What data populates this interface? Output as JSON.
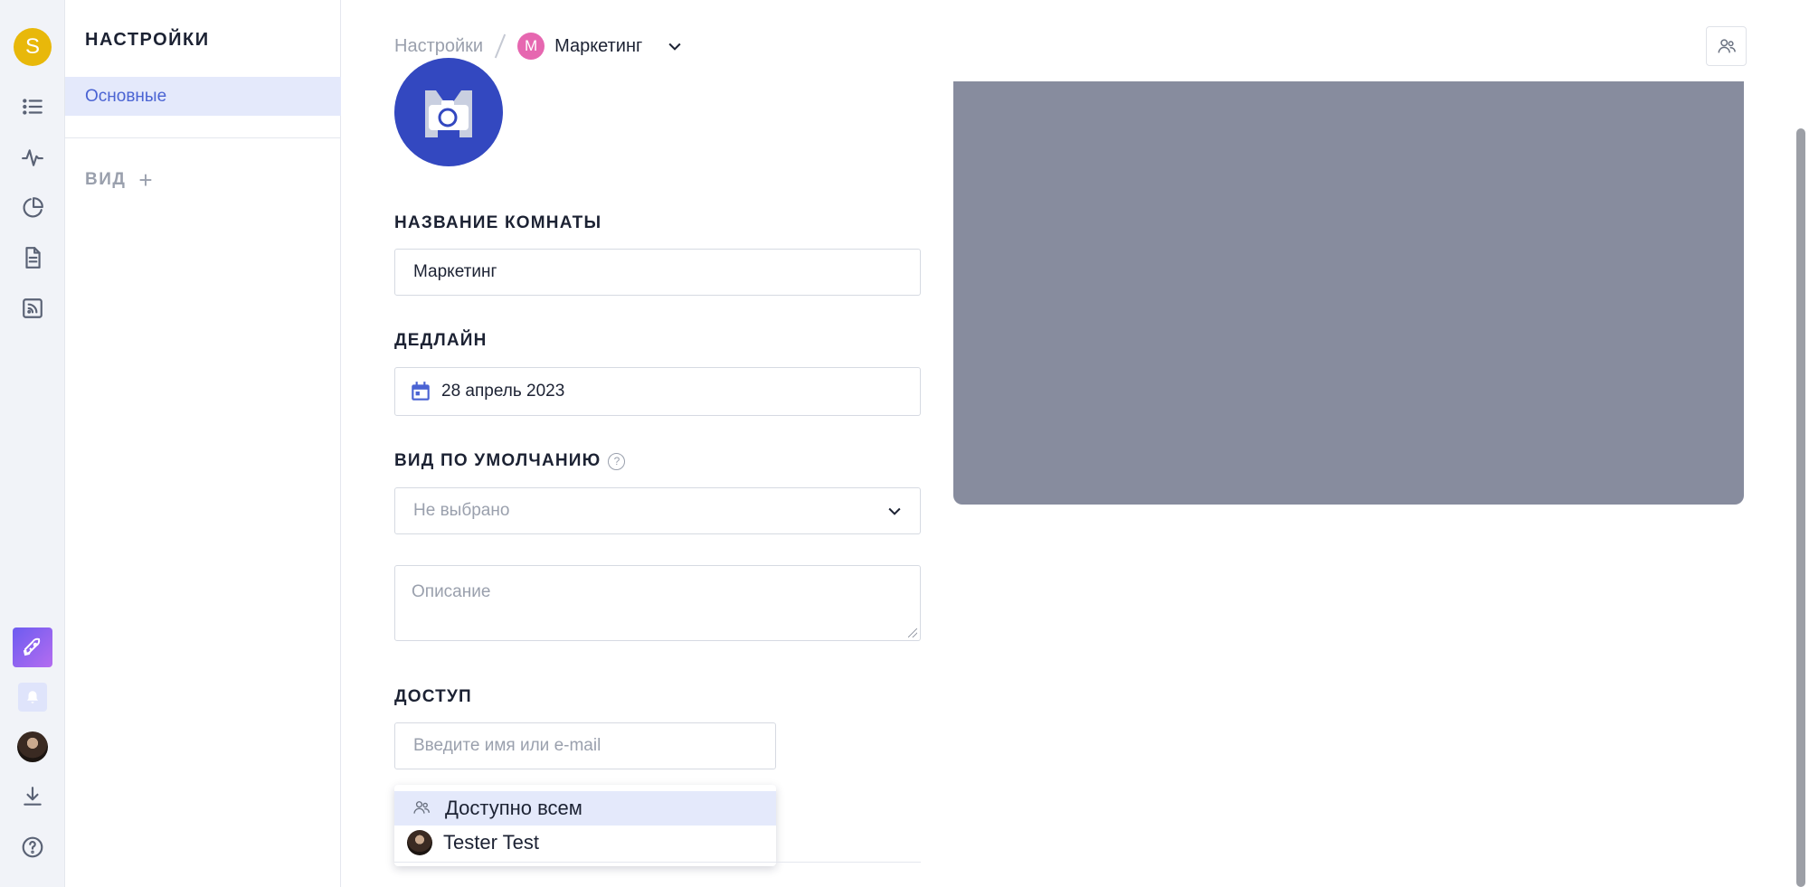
{
  "rail": {
    "workspace_letter": "S",
    "icons": [
      "list-icon",
      "activity-icon",
      "pie-chart-icon",
      "document-icon",
      "feed-icon",
      "rocket-icon",
      "bell-icon",
      "user-avatar",
      "download-icon",
      "help-icon"
    ]
  },
  "sidebar": {
    "title": "НАСТРОЙКИ",
    "items": [
      {
        "label": "Основные",
        "active": true
      }
    ],
    "section_view": "ВИД",
    "add_symbol": "+"
  },
  "header": {
    "crumb_root": "Настройки",
    "room_badge": "M",
    "room_name": "Маркетинг"
  },
  "form": {
    "name_label": "НАЗВАНИЕ КОМНАТЫ",
    "name_value": "Маркетинг",
    "deadline_label": "ДЕДЛАЙН",
    "deadline_value": "28 апрель 2023",
    "default_view_label": "ВИД ПО УМОЛЧАНИЮ",
    "help_symbol": "?",
    "default_view_value": "Не выбрано",
    "description_placeholder": "Описание",
    "access_label": "ДОСТУП",
    "access_placeholder": "Введите имя или e-mail"
  },
  "access_menu": {
    "options": [
      {
        "label": "Доступно всем",
        "icon": "users-icon",
        "active": true
      },
      {
        "label": "Tester Test",
        "icon": "user-avatar",
        "active": false
      }
    ]
  },
  "colors": {
    "accent": "#4a63d3",
    "active_bg": "#e4e9fb",
    "workspace": "#e8b80a",
    "room_badge": "#e667b0",
    "cover": "#878c9e",
    "room_avatar": "#3348c0"
  }
}
